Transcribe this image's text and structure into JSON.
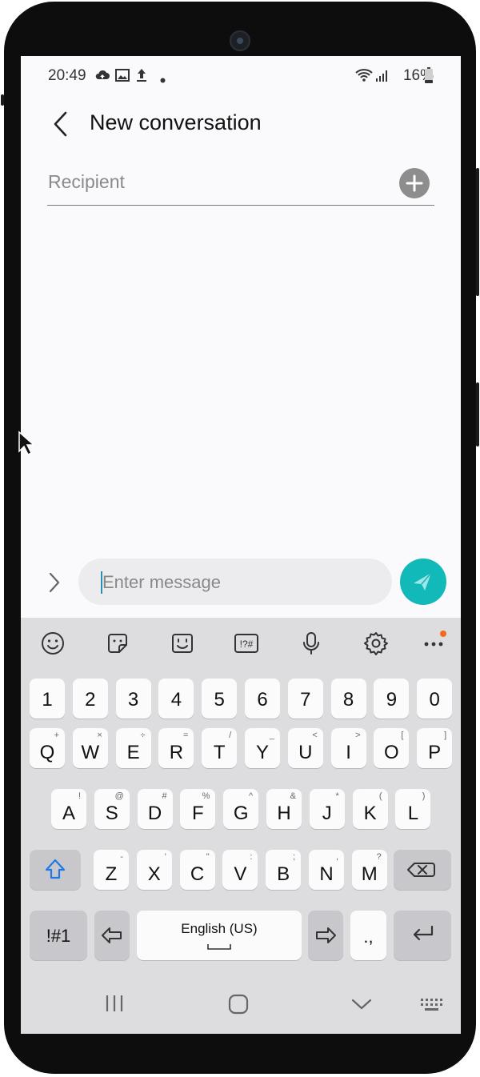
{
  "status_bar": {
    "time": "20:49",
    "battery": "16%"
  },
  "header": {
    "title": "New conversation"
  },
  "recipient": {
    "placeholder": "Recipient"
  },
  "composer": {
    "placeholder": "Enter message"
  },
  "keyboard": {
    "toolbar": [
      "emoji-icon",
      "sticker-icon",
      "bitmoji-icon",
      "symbols-icon",
      "microphone-icon",
      "settings-icon",
      "more-icon"
    ],
    "toolbar_symbols_label": "!?#",
    "numbers": [
      "1",
      "2",
      "3",
      "4",
      "5",
      "6",
      "7",
      "8",
      "9",
      "0"
    ],
    "row1": [
      {
        "key": "Q",
        "sup": "+"
      },
      {
        "key": "W",
        "sup": "×"
      },
      {
        "key": "E",
        "sup": "÷"
      },
      {
        "key": "R",
        "sup": "="
      },
      {
        "key": "T",
        "sup": "/"
      },
      {
        "key": "Y",
        "sup": "_"
      },
      {
        "key": "U",
        "sup": "<"
      },
      {
        "key": "I",
        "sup": ">"
      },
      {
        "key": "O",
        "sup": "["
      },
      {
        "key": "P",
        "sup": "]"
      }
    ],
    "row2": [
      {
        "key": "A",
        "sup": "!"
      },
      {
        "key": "S",
        "sup": "@"
      },
      {
        "key": "D",
        "sup": "#"
      },
      {
        "key": "F",
        "sup": "%"
      },
      {
        "key": "G",
        "sup": "^"
      },
      {
        "key": "H",
        "sup": "&"
      },
      {
        "key": "J",
        "sup": "*"
      },
      {
        "key": "K",
        "sup": "("
      },
      {
        "key": "L",
        "sup": ")"
      }
    ],
    "row3": [
      {
        "key": "Z",
        "sup": "-"
      },
      {
        "key": "X",
        "sup": "'"
      },
      {
        "key": "C",
        "sup": "\""
      },
      {
        "key": "V",
        "sup": ":"
      },
      {
        "key": "B",
        "sup": ";"
      },
      {
        "key": "N",
        "sup": ","
      },
      {
        "key": "M",
        "sup": "?"
      }
    ],
    "symbols_key": "!#1",
    "space_label": "English (US)",
    "punct_key": ".,"
  },
  "colors": {
    "accent": "#11b9b9",
    "notification_dot": "#f06a1e"
  }
}
